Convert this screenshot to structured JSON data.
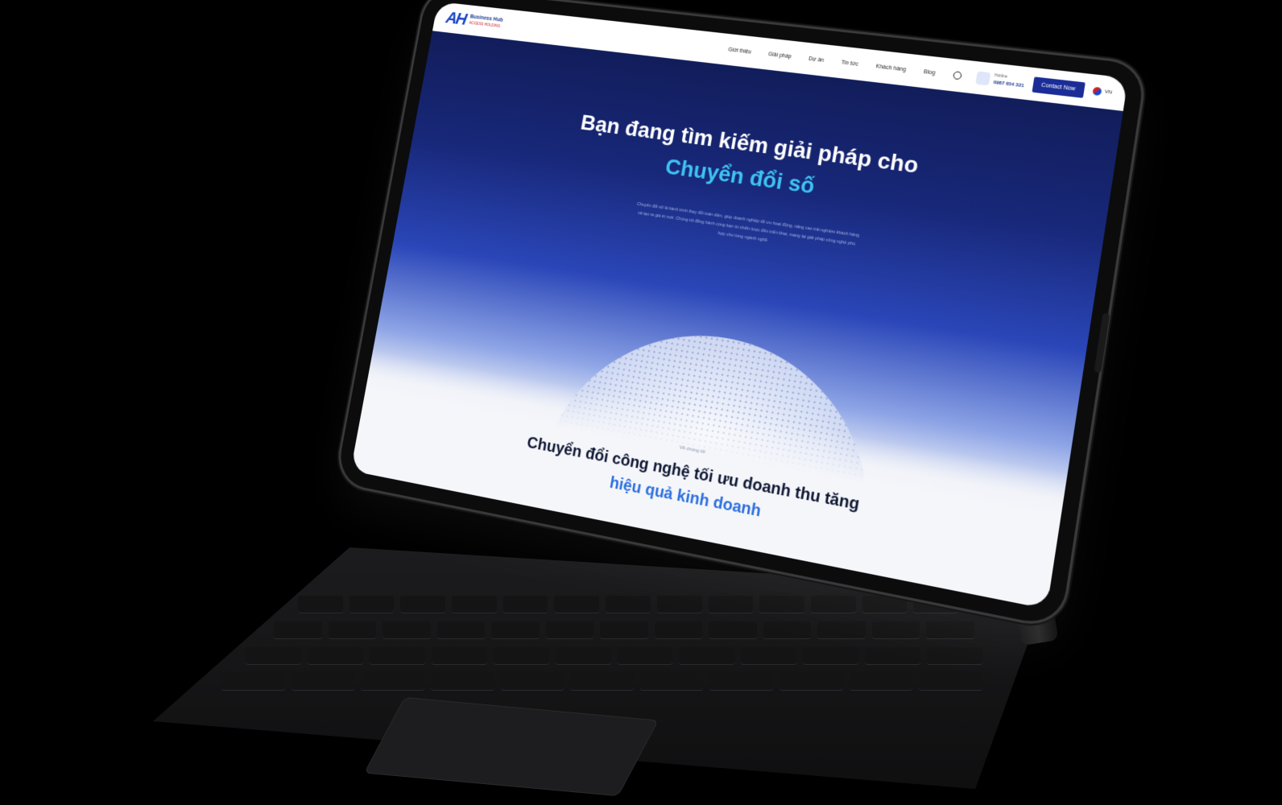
{
  "site": {
    "logo_mark": "AH",
    "logo_name": "Business Hub",
    "logo_tagline": "ACCESS HOLDING"
  },
  "nav": {
    "items": [
      "Giới thiệu",
      "Giải pháp",
      "Dự án",
      "Tin tức",
      "Khách hàng",
      "Blog"
    ],
    "contact_caption": "Hotline",
    "contact_value": "0987 654 321",
    "cta": "Contact Now",
    "lang": "VN"
  },
  "hero": {
    "title": "Bạn đang tìm kiếm giải pháp cho",
    "accent": "Chuyển đổi số",
    "description": "Chuyển đổi số là hành trình thay đổi toàn diện, giúp doanh nghiệp tối ưu hoạt động, nâng cao trải nghiệm khách hàng và tạo ra giá trị mới. Chúng tôi đồng hành cùng bạn từ chiến lược đến triển khai, mang lại giải pháp công nghệ phù hợp cho từng ngành nghề."
  },
  "section": {
    "tag": "Về chúng tôi",
    "title": "Chuyển đổi công nghệ tối ưu doanh thu tăng",
    "accent": "hiệu quả kinh doanh"
  }
}
